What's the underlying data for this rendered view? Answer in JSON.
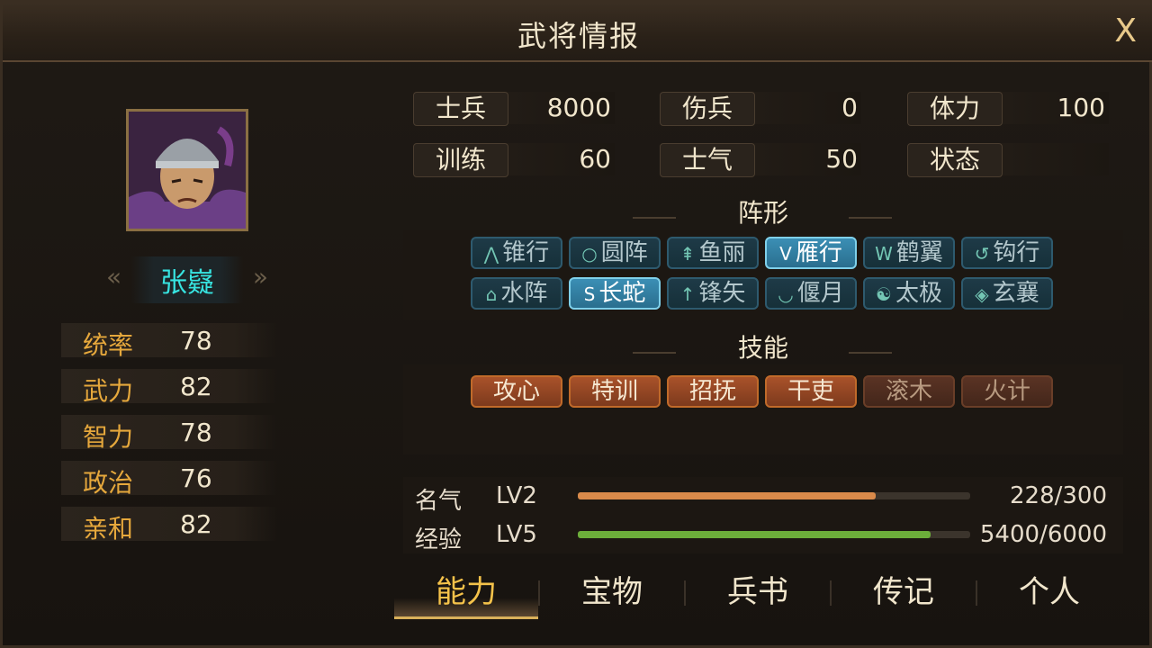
{
  "window": {
    "title": "武将情报",
    "close_label": "X"
  },
  "general": {
    "name": "张嶷",
    "stats": [
      {
        "label": "统率",
        "value": "78"
      },
      {
        "label": "武力",
        "value": "82"
      },
      {
        "label": "智力",
        "value": "78"
      },
      {
        "label": "政治",
        "value": "76"
      },
      {
        "label": "亲和",
        "value": "82"
      }
    ]
  },
  "info": [
    {
      "label": "士兵",
      "value": "8000"
    },
    {
      "label": "伤兵",
      "value": "0"
    },
    {
      "label": "体力",
      "value": "100"
    },
    {
      "label": "训练",
      "value": "60"
    },
    {
      "label": "士气",
      "value": "50"
    },
    {
      "label": "状态",
      "value": ""
    }
  ],
  "formation": {
    "title": "阵形",
    "items": [
      {
        "icon": "⋀",
        "label": "锥行",
        "active": false
      },
      {
        "icon": "○",
        "label": "圆阵",
        "active": false
      },
      {
        "icon": "⇞",
        "label": "鱼丽",
        "active": false
      },
      {
        "icon": "V",
        "label": "雁行",
        "active": true
      },
      {
        "icon": "W",
        "label": "鹤翼",
        "active": false
      },
      {
        "icon": "↺",
        "label": "钩行",
        "active": false
      },
      {
        "icon": "⌂",
        "label": "水阵",
        "active": false
      },
      {
        "icon": "S",
        "label": "长蛇",
        "active": true
      },
      {
        "icon": "↑",
        "label": "锋矢",
        "active": false
      },
      {
        "icon": "◡",
        "label": "偃月",
        "active": false
      },
      {
        "icon": "☯",
        "label": "太极",
        "active": false
      },
      {
        "icon": "◈",
        "label": "玄襄",
        "active": false
      }
    ]
  },
  "skills": {
    "title": "技能",
    "items": [
      {
        "label": "攻心",
        "enabled": true
      },
      {
        "label": "特训",
        "enabled": true
      },
      {
        "label": "招抚",
        "enabled": true
      },
      {
        "label": "干吏",
        "enabled": true
      },
      {
        "label": "滚木",
        "enabled": false
      },
      {
        "label": "火计",
        "enabled": false
      }
    ]
  },
  "progress": [
    {
      "label": "名气",
      "level": "LV2",
      "text": "228/300",
      "fraction": 0.76,
      "color": "#d98a4a"
    },
    {
      "label": "经验",
      "level": "LV5",
      "text": "5400/6000",
      "fraction": 0.9,
      "color": "#6cae3a"
    }
  ],
  "tabs": [
    {
      "label": "能力",
      "active": true
    },
    {
      "label": "宝物",
      "active": false
    },
    {
      "label": "兵书",
      "active": false
    },
    {
      "label": "传记",
      "active": false
    },
    {
      "label": "个人",
      "active": false
    }
  ]
}
